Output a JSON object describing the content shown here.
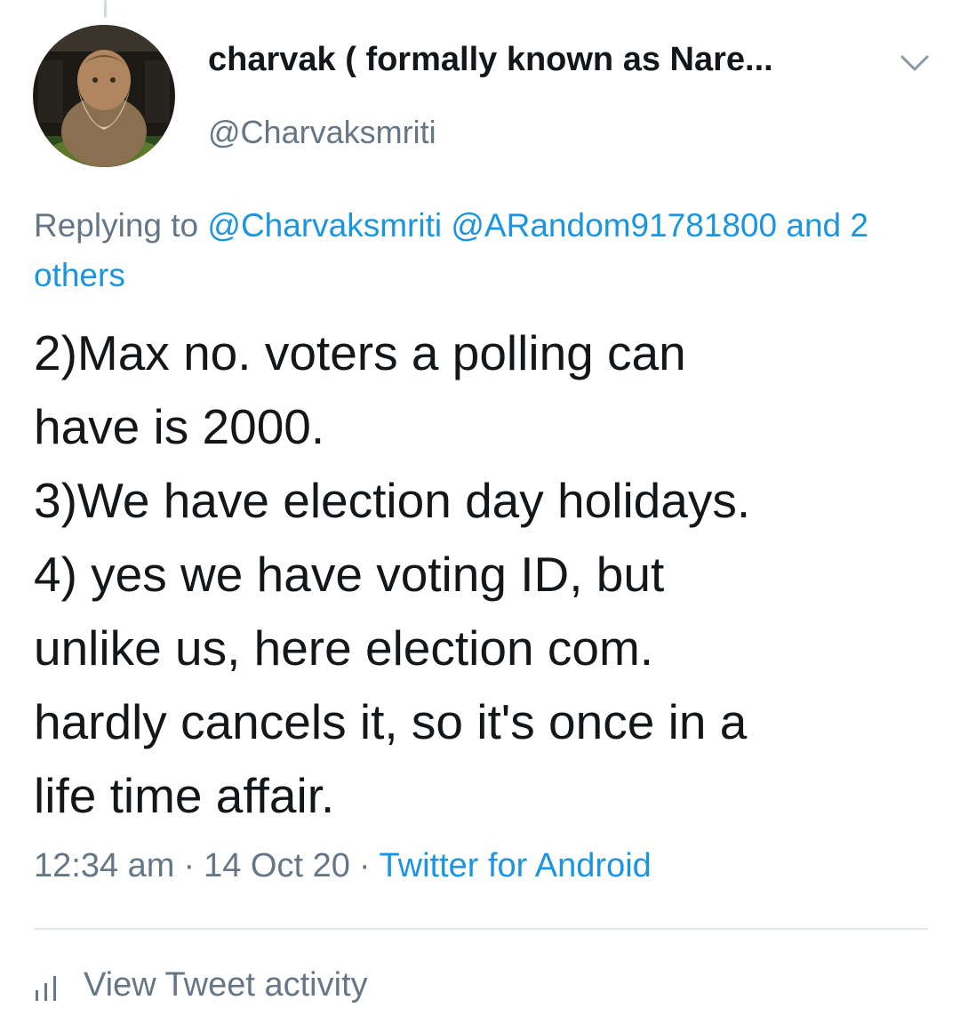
{
  "tweet": {
    "author_name": "charvak ( formally known as Nare...",
    "author_handle": "@Charvaksmriti",
    "replying_prefix": "Replying to",
    "mentions": [
      "@Charvaksmriti",
      "@ARandom91781800",
      "and 2 others"
    ],
    "text_lines": [
      "2)Max no. voters a polling can",
      "have is 2000.",
      "3)We have election day holidays.",
      "4) yes we have voting ID, but",
      "unlike us, here election com.",
      "hardly cancels it, so it's once in a",
      "life time affair."
    ],
    "time": "12:34 am",
    "date": "14 Oct 20",
    "separator": "·",
    "source": "Twitter for Android",
    "activity_label": "View Tweet activity"
  },
  "icons": {
    "menu": "chevron-down-icon",
    "activity": "bar-chart-icon"
  },
  "colors": {
    "link": "#1b95e0",
    "secondary_text": "#657786",
    "primary_text": "#14171a",
    "divider": "#e1e8ed"
  }
}
